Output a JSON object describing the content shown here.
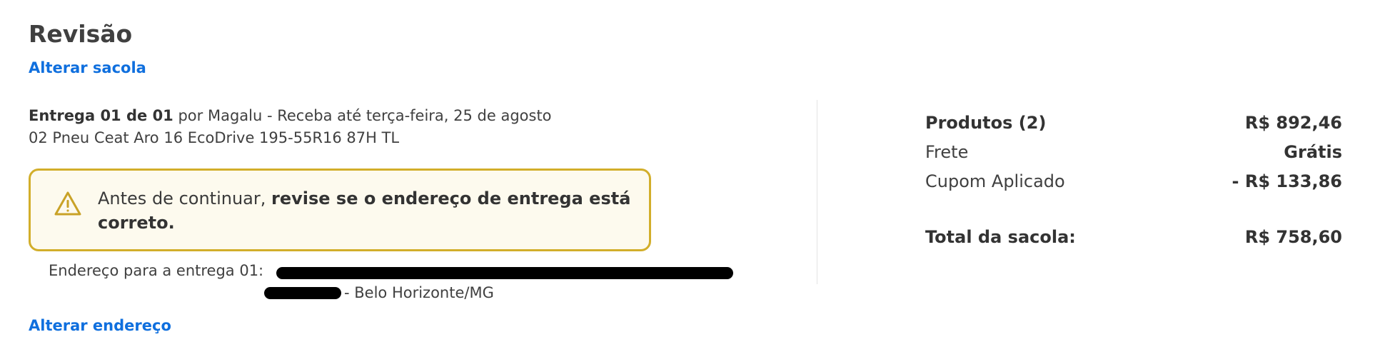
{
  "review": {
    "title": "Revisão",
    "change_bag_link": "Alterar sacola",
    "delivery": {
      "label": "Entrega 01 de 01",
      "text": " por Magalu - Receba até terça-feira, 25 de agosto",
      "product": "02 Pneu Ceat Aro 16 EcoDrive 195-55R16 87H TL"
    },
    "alert": {
      "icon": "warning-icon",
      "text_prefix": "Antes de continuar, ",
      "text_bold": "revise se o endereço de entrega está correto."
    },
    "address": {
      "label": "Endereço para a entrega 01:",
      "city": "- Belo Horizonte/MG"
    },
    "change_address_link": "Alterar endereço"
  },
  "summary": {
    "products_label": "Produtos (2)",
    "products_value": "R$ 892,46",
    "shipping_label": "Frete",
    "shipping_value": "Grátis",
    "coupon_label": "Cupom Aplicado",
    "coupon_value": "- R$ 133,86",
    "total_label": "Total da sacola:",
    "total_value": "R$ 758,60"
  },
  "colors": {
    "link": "#0f6fde",
    "alert_border": "#d2ae2a",
    "alert_background": "#fdfaee"
  }
}
